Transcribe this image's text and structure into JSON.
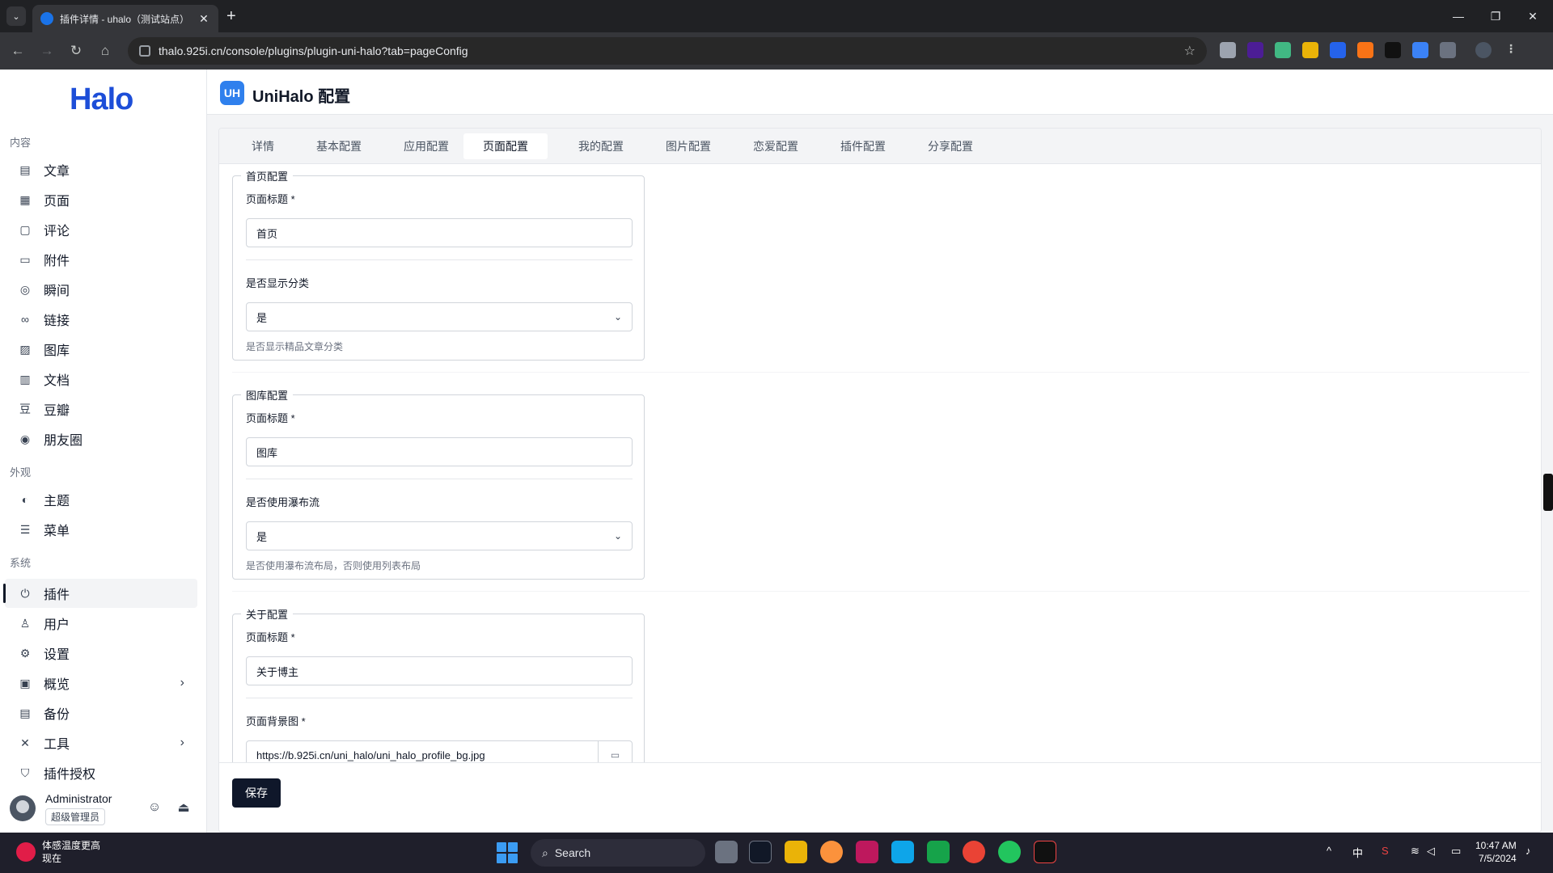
{
  "browser": {
    "tab_title": "插件详情 - uhalo（测试站点）",
    "url": "thalo.925i.cn/console/plugins/plugin-uni-halo?tab=pageConfig"
  },
  "sidebar": {
    "logo": "Halo",
    "sections": {
      "content": "内容",
      "appearance": "外观",
      "system": "系统"
    },
    "content_items": [
      "文章",
      "页面",
      "评论",
      "附件",
      "瞬间",
      "链接",
      "图库",
      "文档",
      "豆瓣",
      "朋友圈"
    ],
    "appearance_items": [
      "主题",
      "菜单"
    ],
    "system_items": [
      "插件",
      "用户",
      "设置",
      "概览",
      "备份",
      "工具",
      "插件授权"
    ],
    "user": {
      "name": "Administrator",
      "role": "超级管理员"
    }
  },
  "header": {
    "logo_text": "UH",
    "title": "UniHalo 配置"
  },
  "tabs": [
    "详情",
    "基本配置",
    "应用配置",
    "页面配置",
    "我的配置",
    "图片配置",
    "恋爱配置",
    "插件配置",
    "分享配置"
  ],
  "active_tab": "页面配置",
  "form": {
    "home": {
      "legend": "首页配置",
      "title_label": "页面标题 *",
      "title_value": "首页",
      "show_category_label": "是否显示分类",
      "show_category_value": "是",
      "show_category_help": "是否显示精品文章分类"
    },
    "gallery": {
      "legend": "图库配置",
      "title_label": "页面标题 *",
      "title_value": "图库",
      "waterfall_label": "是否使用瀑布流",
      "waterfall_value": "是",
      "waterfall_help": "是否使用瀑布流布局，否则使用列表布局"
    },
    "about": {
      "legend": "关于配置",
      "title_label": "页面标题 *",
      "title_value": "关于博主",
      "bg_label": "页面背景图 *",
      "bg_value": "https://b.925i.cn/uni_halo/uni_halo_profile_bg.jpg"
    }
  },
  "save_label": "保存",
  "taskbar": {
    "weather_title": "体感温度更高",
    "weather_sub": "现在",
    "search": "Search",
    "ime": "中",
    "time": "10:47 AM",
    "date": "7/5/2024"
  }
}
